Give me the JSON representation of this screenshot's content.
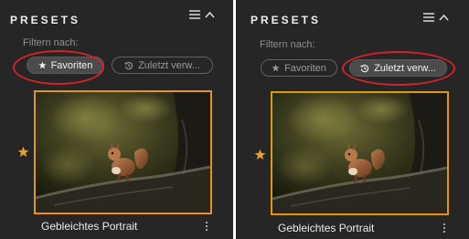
{
  "colors": {
    "panel_bg": "#262626",
    "accent_selected_border": "#e39516",
    "favorite_star": "#e8a12a",
    "annotation_circle": "#d2232a",
    "pill_active_bg": "#4b4b4b"
  },
  "panels": [
    {
      "title": "PRESETS",
      "header_icons": [
        "menu-icon",
        "chevron-up-icon"
      ],
      "filter_label": "Filtern nach:",
      "filters": [
        {
          "label": "Favoriten",
          "icon": "star-icon",
          "active": true
        },
        {
          "label": "Zuletzt verw...",
          "icon": "history-icon",
          "active": false
        }
      ],
      "highlighted_filter": "Favoriten",
      "preset": {
        "name": "Gebleichtes Portrait",
        "favorite": true,
        "selected": true
      }
    },
    {
      "title": "PRESETS",
      "header_icons": [
        "menu-icon",
        "chevron-up-icon"
      ],
      "filter_label": "Filtern nach:",
      "filters": [
        {
          "label": "Favoriten",
          "icon": "star-icon",
          "active": false
        },
        {
          "label": "Zuletzt verw...",
          "icon": "history-icon",
          "active": true
        }
      ],
      "highlighted_filter": "Zuletzt verw...",
      "preset": {
        "name": "Gebleichtes Portrait",
        "favorite": true,
        "selected": true
      }
    }
  ]
}
